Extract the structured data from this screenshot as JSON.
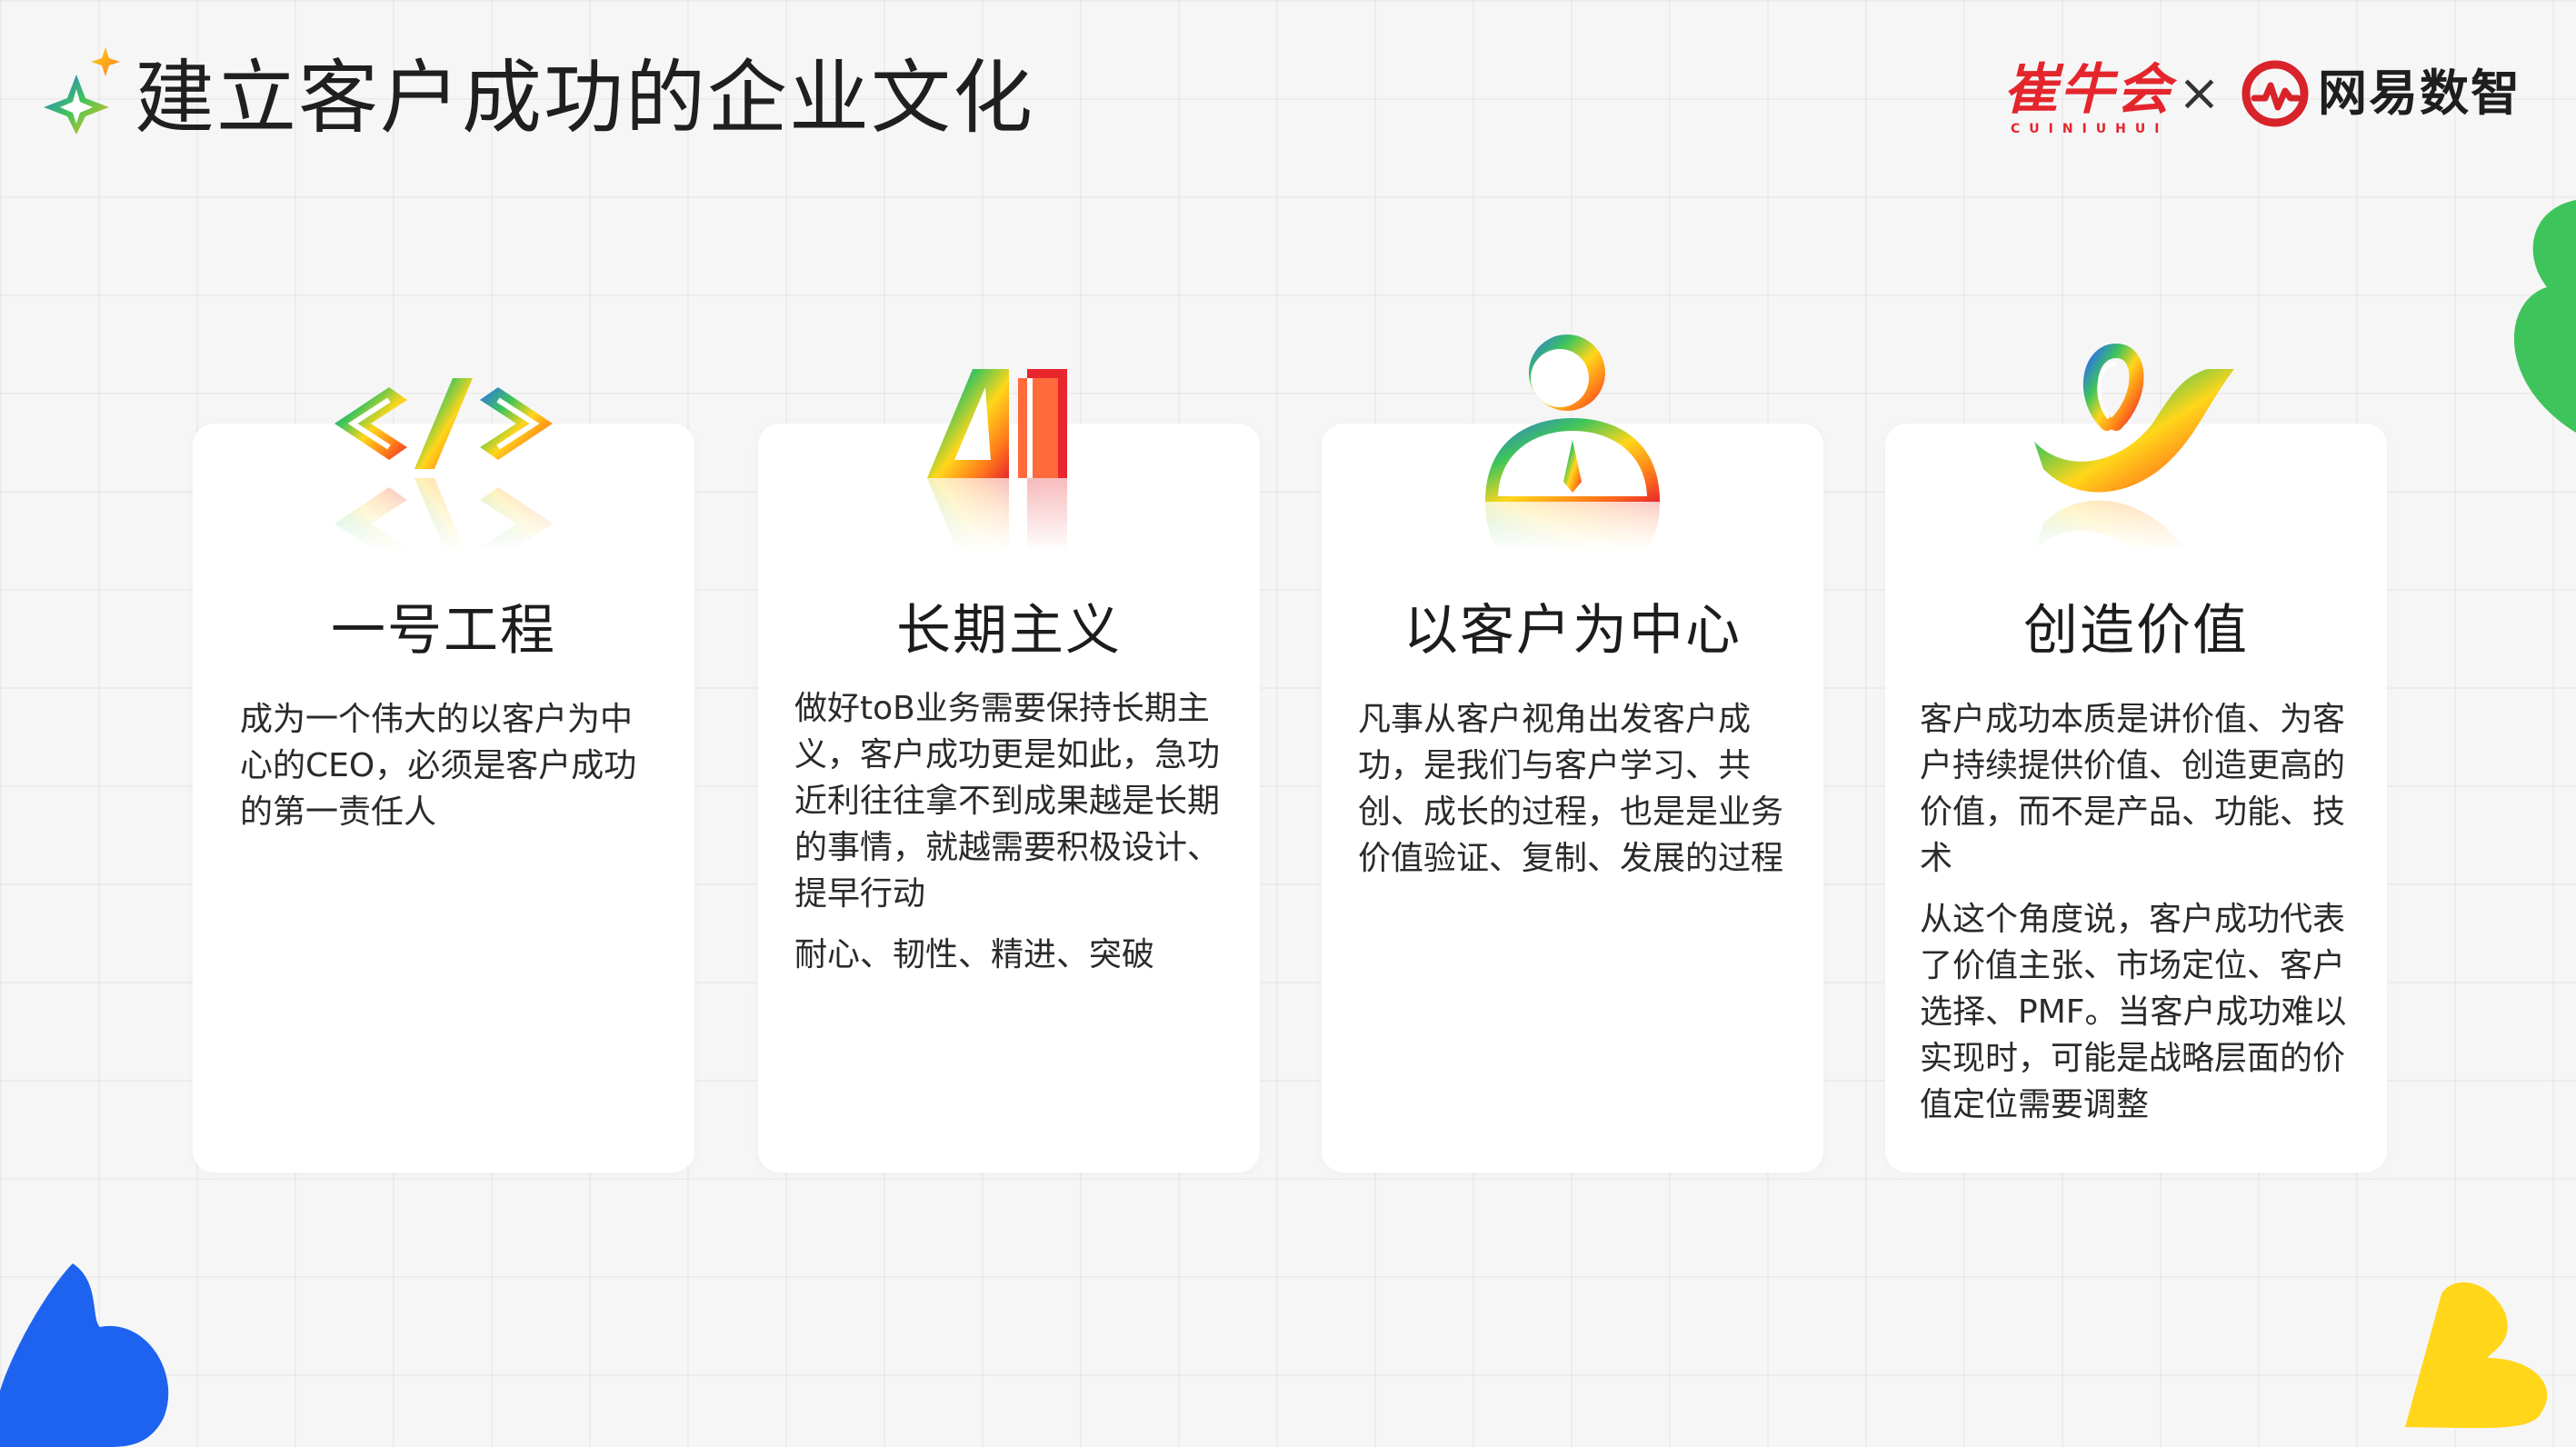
{
  "header": {
    "title": "建立客户成功的企业文化"
  },
  "logos": {
    "cuiniu_cn": "崔牛会",
    "cuiniu_en": "CUINIUHUI",
    "separator": "×",
    "netease_text": "网易数智"
  },
  "cards": [
    {
      "title": "一号工程",
      "icon": "code-brackets-icon",
      "paragraphs": [
        "成为一个伟大的以客户为中心的CEO，必须是客户成功的第一责任人"
      ]
    },
    {
      "title": "长期主义",
      "icon": "ai-letters-icon",
      "paragraphs": [
        "做好toB业务需要保持长期主义，客户成功更是如此，急功近利往往拿不到成果越是长期的事情，就越需要积极设计、提早行动",
        "耐心、韧性、精进、突破"
      ]
    },
    {
      "title": "以客户为中心",
      "icon": "person-tie-icon",
      "paragraphs": [
        "凡事从客户视角出发客户成功，是我们与客户学习、共创、成长的过程，也是是业务价值验证、复制、发展的过程"
      ]
    },
    {
      "title": "创造价值",
      "icon": "ribbon-icon",
      "paragraphs": [
        "客户成功本质是讲价值、为客户持续提供价值、创造更高的价值，而不是产品、功能、技术",
        "从这个角度说，客户成功代表了价值主张、市场定位、客户选择、PMF。当客户成功难以实现时，可能是战略层面的价值定位需要调整"
      ]
    }
  ],
  "colors": {
    "background": "#f6f6f7",
    "card": "#ffffff",
    "brand_red": "#e4262c",
    "blob_green": "#3ec45a",
    "blob_blue": "#1e63f0",
    "blob_yellow": "#ffd61a"
  }
}
